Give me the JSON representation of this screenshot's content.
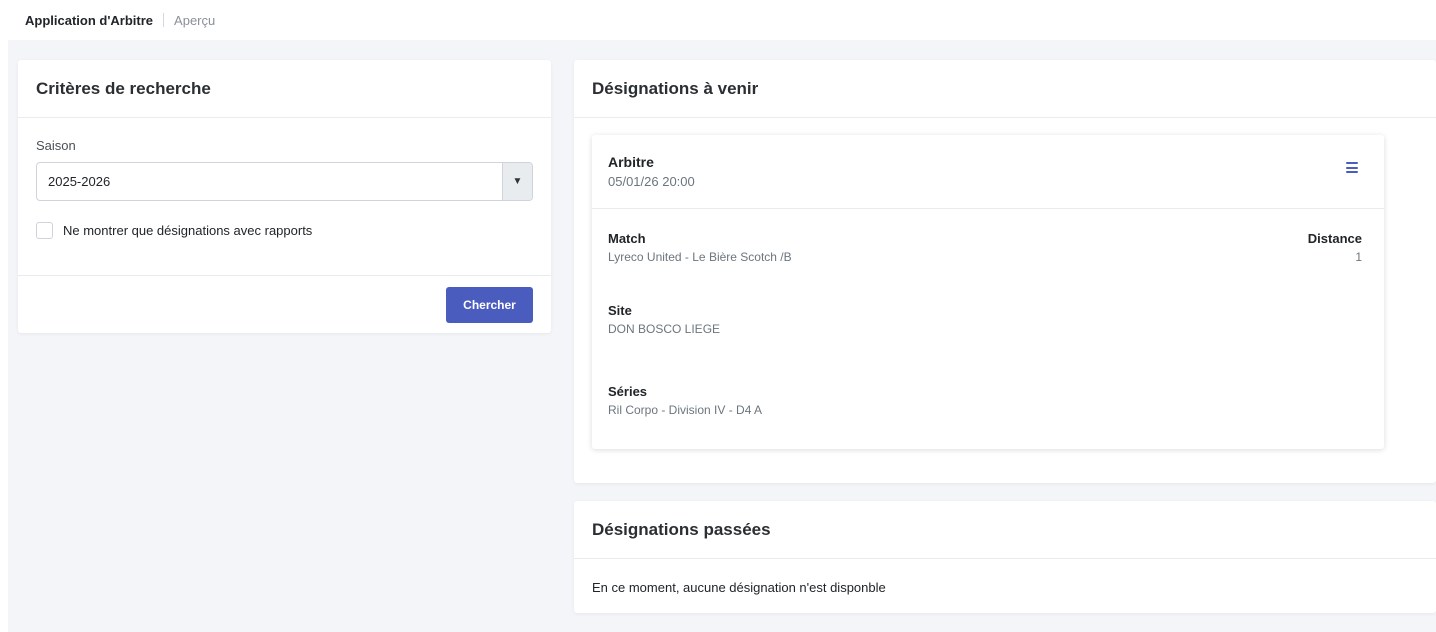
{
  "header": {
    "app_title": "Application d'Arbitre",
    "breadcrumb": "Aperçu"
  },
  "search": {
    "title": "Critères de recherche",
    "season_label": "Saison",
    "season_value": "2025-2026",
    "checkbox_label": "Ne montrer que désignations avec rapports",
    "checkbox_checked": false,
    "search_button": "Chercher"
  },
  "upcoming": {
    "title": "Désignations à venir",
    "assignment": {
      "role": "Arbitre",
      "datetime": "05/01/26 20:00",
      "match_label": "Match",
      "match_value": "Lyreco United - Le Bière Scotch /B",
      "distance_label": "Distance",
      "distance_value": "1",
      "site_label": "Site",
      "site_value": "DON BOSCO LIEGE",
      "series_label": "Séries",
      "series_value": "Ril Corpo - Division IV - D4 A"
    }
  },
  "past": {
    "title": "Désignations passées",
    "empty_message": "En ce moment, aucune désignation n'est disponble"
  },
  "colors": {
    "accent": "#4b5cbf",
    "background": "#f3f5f8"
  },
  "icons": {
    "select_arrow": "caret-down-icon",
    "assignment_menu": "hamburger-menu-icon"
  }
}
